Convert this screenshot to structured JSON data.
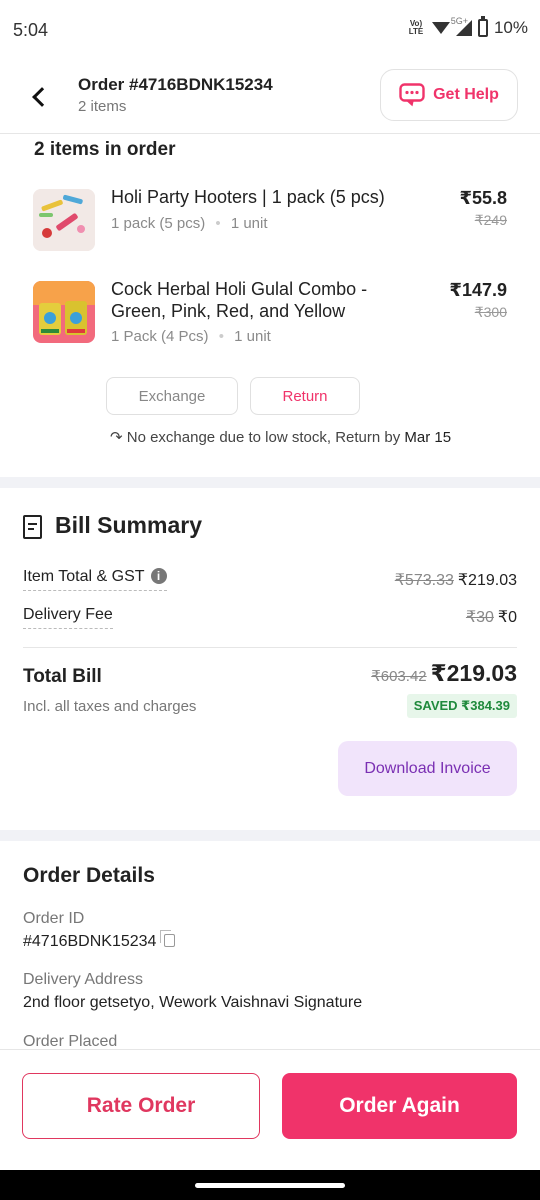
{
  "status_bar": {
    "time": "5:04",
    "network_badge": "Vo) LTE",
    "network_type": "5G+",
    "battery": "10%"
  },
  "header": {
    "order_title": "Order #4716BDNK15234",
    "items_count": "2 items",
    "help_label": "Get Help"
  },
  "items_section": {
    "heading": "2 items in order",
    "items": [
      {
        "name": "Holi Party Hooters | 1 pack (5 pcs)",
        "pack": "1 pack (5 pcs)",
        "qty": "1 unit",
        "price": "₹55.8",
        "mrp": "₹249"
      },
      {
        "name": "Cock Herbal Holi Gulal Combo - Green, Pink, Red, and Yellow",
        "pack": "1 Pack (4 Pcs)",
        "qty": "1 unit",
        "price": "₹147.9",
        "mrp": "₹300"
      }
    ],
    "exchange_label": "Exchange",
    "return_label": "Return",
    "note": "No exchange due to low stock, Return by",
    "note_date": "Mar 15",
    "meta_separator": "•"
  },
  "bill": {
    "title": "Bill Summary",
    "item_total_label": "Item Total & GST",
    "item_total_mrp": "₹573.33",
    "item_total_value": "₹219.03",
    "delivery_label": "Delivery Fee",
    "delivery_mrp": "₹30",
    "delivery_value": "₹0",
    "total_label": "Total Bill",
    "total_sub": "Incl. all taxes and charges",
    "total_mrp": "₹603.42",
    "total_value": "₹219.03",
    "saved": "SAVED ₹384.39",
    "invoice_label": "Download Invoice"
  },
  "details": {
    "title": "Order Details",
    "order_id_label": "Order ID",
    "order_id_value": "#4716BDNK15234",
    "address_label": "Delivery Address",
    "address_value": "2nd floor getsetyo, Wework Vaishnavi Signature",
    "placed_label": "Order Placed"
  },
  "bottom": {
    "rate_label": "Rate Order",
    "again_label": "Order Again"
  },
  "colors": {
    "accent": "#f0336a",
    "invoice_bg": "#f1e4fb",
    "invoice_text": "#7a2fb3",
    "saved_bg": "#e7f6ea",
    "saved_text": "#1f8a3c"
  }
}
